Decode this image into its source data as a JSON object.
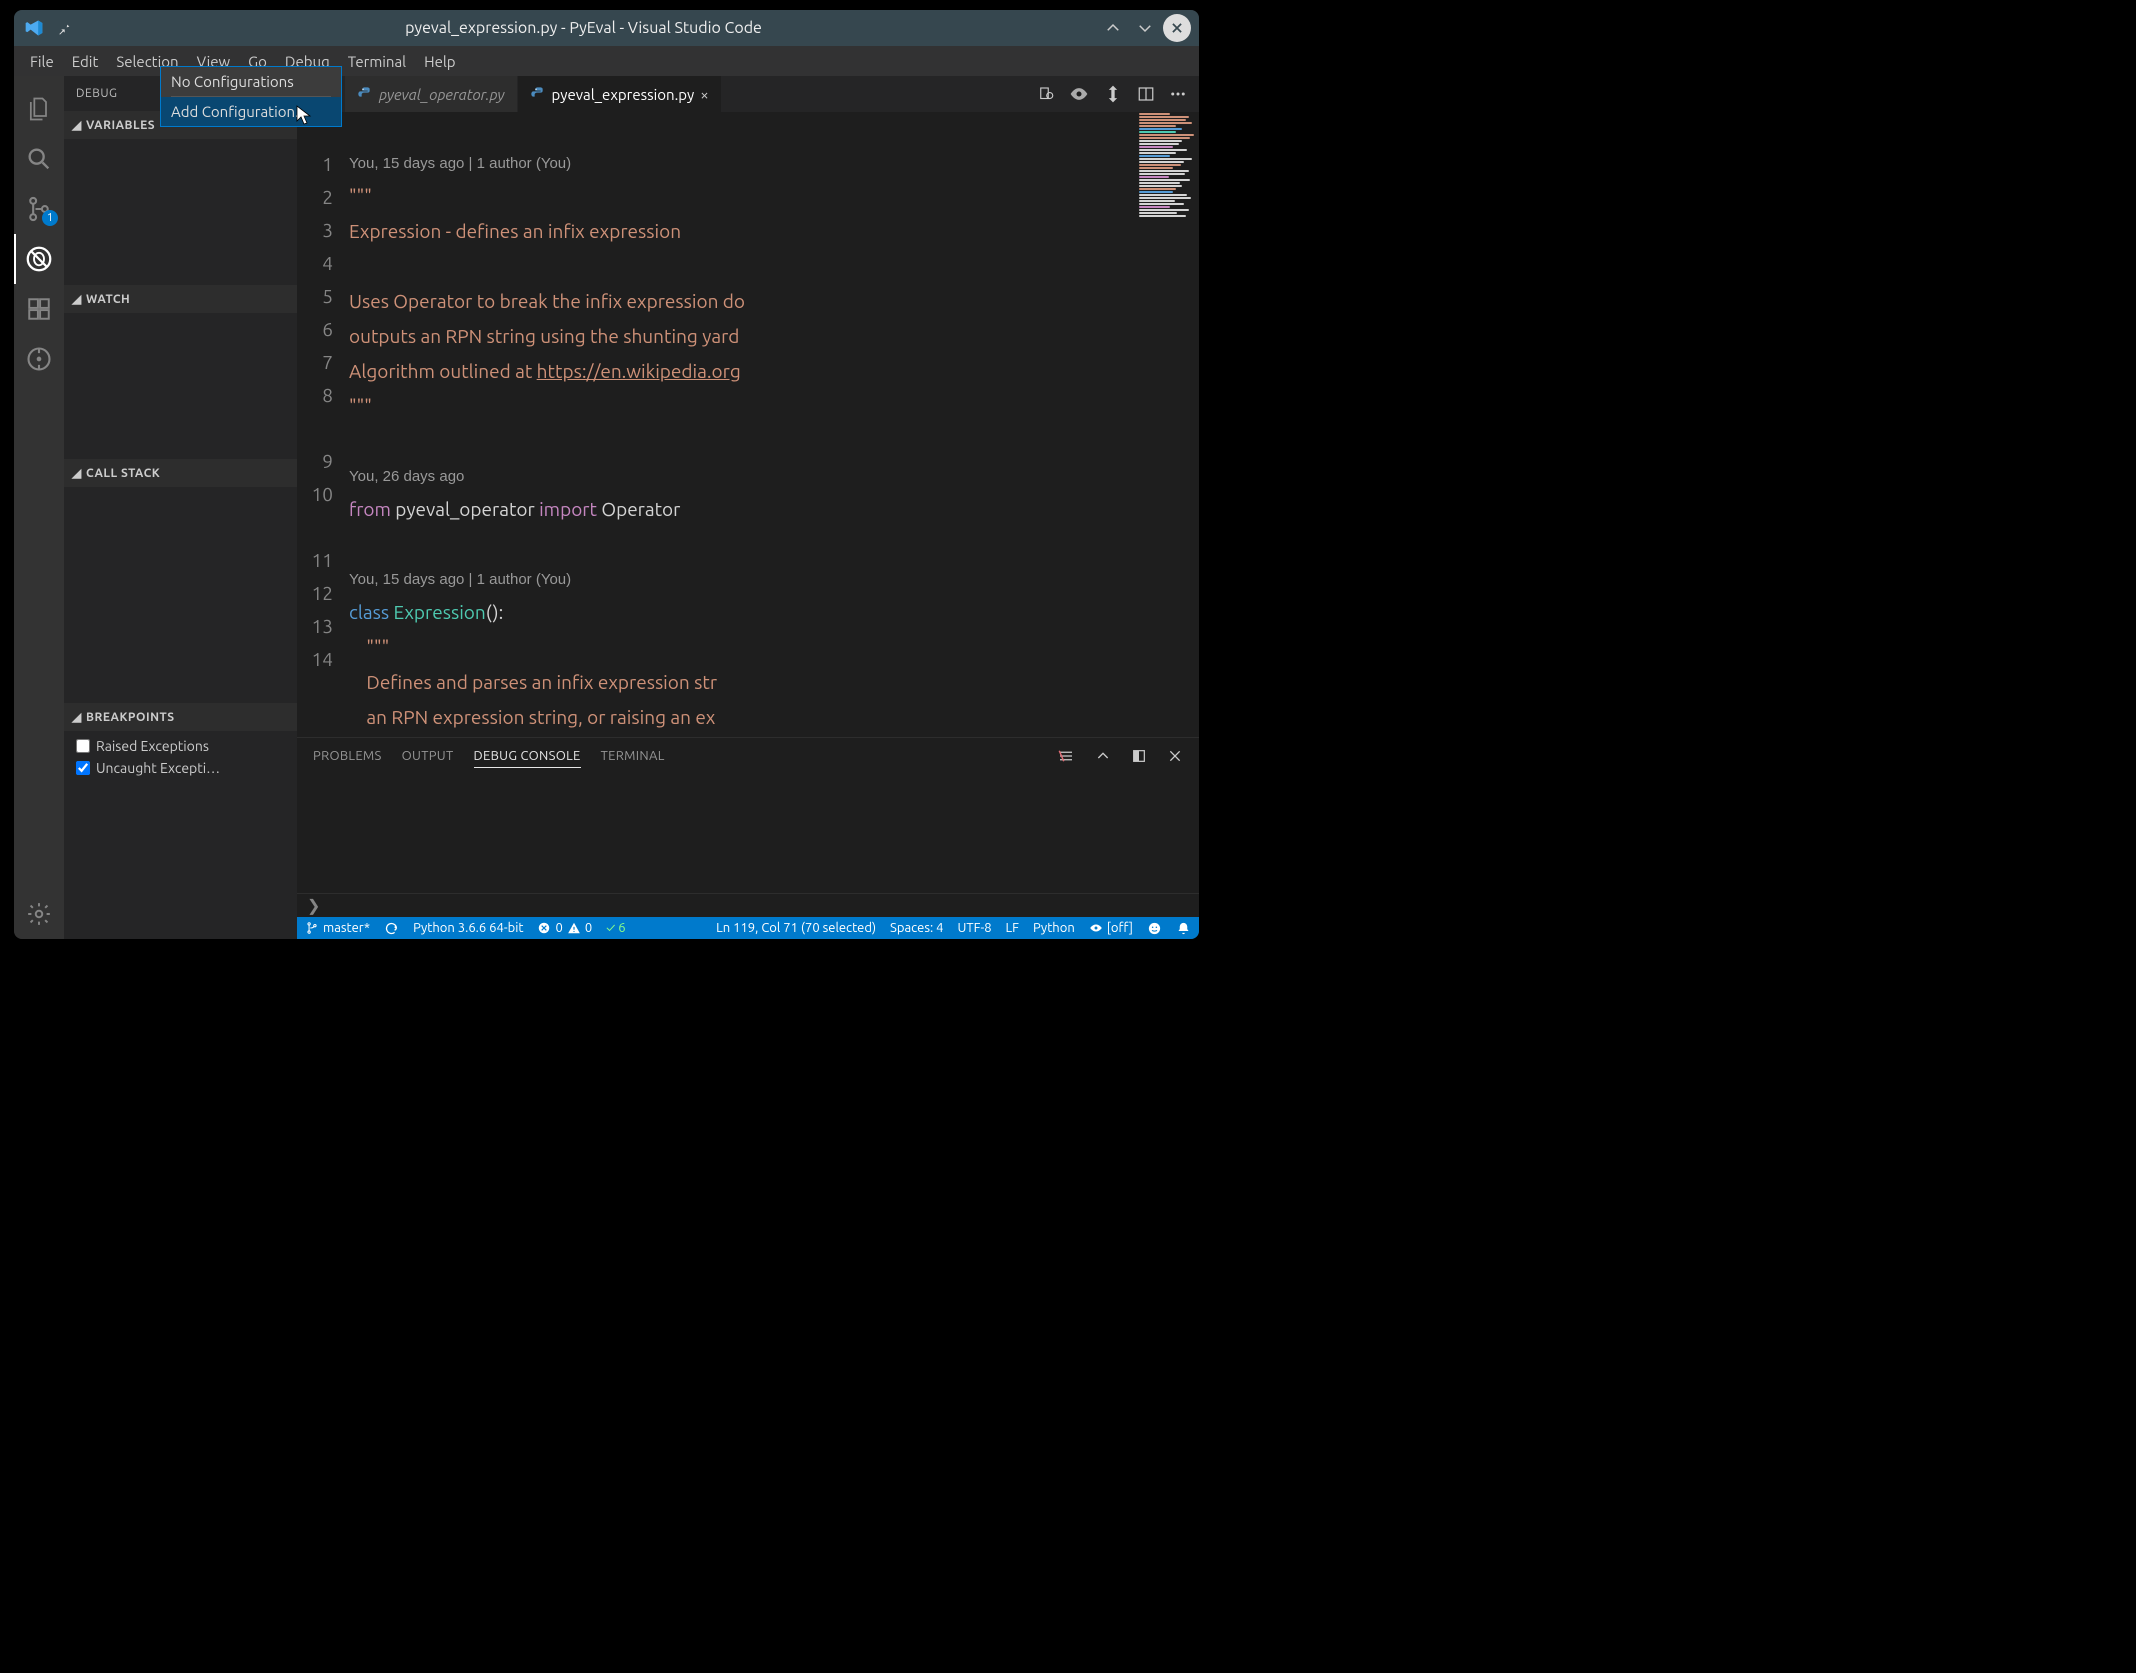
{
  "window": {
    "title": "pyeval_expression.py - PyEval - Visual Studio Code"
  },
  "menu": {
    "items": [
      "File",
      "Edit",
      "Selection",
      "View",
      "Go",
      "Debug",
      "Terminal",
      "Help"
    ]
  },
  "activitybar": {
    "items": [
      {
        "name": "explorer-icon"
      },
      {
        "name": "search-icon"
      },
      {
        "name": "scm-icon",
        "badge": "1"
      },
      {
        "name": "debug-icon",
        "active": true
      },
      {
        "name": "extensions-icon"
      },
      {
        "name": "gitlens-icon"
      }
    ],
    "settings": {
      "name": "gear-icon"
    }
  },
  "sidebar": {
    "title": "DEBUG",
    "sections": {
      "variables": "VARIABLES",
      "watch": "WATCH",
      "callstack": "CALL STACK",
      "breakpoints": "BREAKPOINTS"
    },
    "breakpoints": [
      {
        "label": "Raised Exceptions",
        "checked": false
      },
      {
        "label": "Uncaught Excepti…",
        "checked": true
      }
    ]
  },
  "dropdown": {
    "item1": "No Configurations",
    "item2": "Add Configuration..."
  },
  "tabs": [
    {
      "label": "pyeval_operator.py",
      "active": false
    },
    {
      "label": "pyeval_expression.py",
      "active": true
    }
  ],
  "editor": {
    "gutter": [
      "1",
      "2",
      "3",
      "4",
      "5",
      "6",
      "7",
      "8",
      "",
      "9",
      "10",
      "",
      "11",
      "12",
      "13",
      "14"
    ],
    "codelens1": "You, 15 days ago | 1 author (You)",
    "codelens2": "You, 26 days ago",
    "codelens3": "You, 15 days ago | 1 author (You)",
    "l1": "\"\"\"",
    "l2": "Expression - defines an infix expression",
    "l4": "Uses Operator to break the infix expression do",
    "l5": "outputs an RPN string using the shunting yard ",
    "l6a": "Algorithm outlined at ",
    "l6b": "https://en.wikipedia.org",
    "l7": "\"\"\"",
    "l9a": "from",
    "l9b": " pyeval_operator ",
    "l9c": "import",
    "l9d": " Operator",
    "l11a": "class",
    "l11b": " ",
    "l11c": "Expression",
    "l11d": "():",
    "l12": "    \"\"\"",
    "l13": "    Defines and parses an infix expression str",
    "l14": "    an RPN expression string, or raising an ex"
  },
  "panel": {
    "tabs": [
      "PROBLEMS",
      "OUTPUT",
      "DEBUG CONSOLE",
      "TERMINAL"
    ],
    "active_index": 2,
    "prompt": "❯"
  },
  "statusbar": {
    "branch": "master*",
    "python": "Python 3.6.6 64-bit",
    "errors": "0",
    "warnings": "0",
    "tests": "✓ 6",
    "position": "Ln 119, Col 71 (70 selected)",
    "spaces": "Spaces: 4",
    "encoding": "UTF-8",
    "eol": "LF",
    "language": "Python",
    "liveshare": "[off]"
  }
}
